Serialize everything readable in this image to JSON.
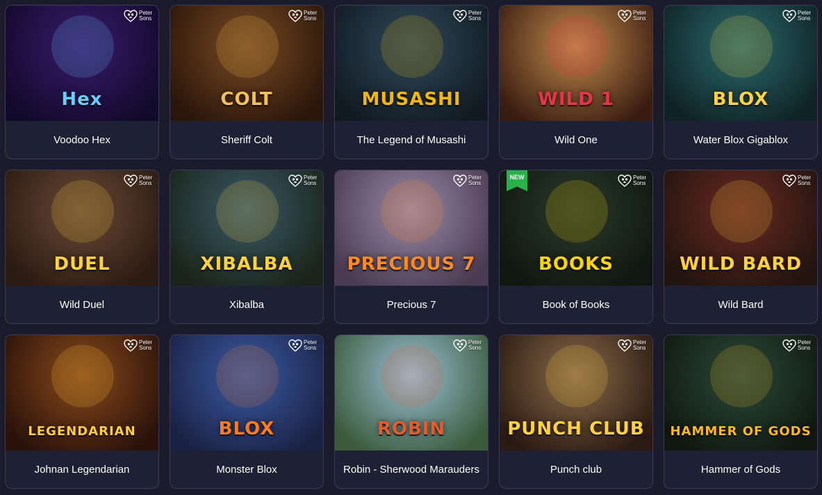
{
  "provider": {
    "line1": "Peter",
    "line2": "Sons",
    "icon": "heart-skull-logo"
  },
  "games": [
    {
      "title": "Voodoo Hex",
      "art_title": "Hex",
      "bg1": "#3a1a6e",
      "bg2": "#120a2a",
      "accent": "#5fd0ff"
    },
    {
      "title": "Sheriff Colt",
      "art_title": "COLT",
      "bg1": "#7a4a22",
      "bg2": "#2a160a",
      "accent": "#f2c14e"
    },
    {
      "title": "The Legend of Musashi",
      "art_title": "MUSASHI",
      "bg1": "#2f4a5a",
      "bg2": "#111a22",
      "accent": "#f5b800"
    },
    {
      "title": "Wild One",
      "art_title": "WILD 1",
      "bg1": "#c08a4a",
      "bg2": "#3a1d12",
      "accent": "#e8344a"
    },
    {
      "title": "Water Blox Gigablox",
      "art_title": "BLOX",
      "bg1": "#2b6a6a",
      "bg2": "#0f2226",
      "accent": "#ffd23a"
    },
    {
      "title": "Wild Duel",
      "art_title": "DUEL",
      "bg1": "#6a4a36",
      "bg2": "#2a1a12",
      "accent": "#ffd23a"
    },
    {
      "title": "Xibalba",
      "art_title": "XIBALBA",
      "bg1": "#3a5a6a",
      "bg2": "#1a2418",
      "accent": "#ffd23a"
    },
    {
      "title": "Precious 7",
      "art_title": "PRECIOUS 7",
      "bg1": "#9a8aa4",
      "bg2": "#4a3a52",
      "accent": "#ff8a20"
    },
    {
      "title": "Book of Books",
      "art_title": "BOOKS",
      "bg1": "#2a3a2a",
      "bg2": "#0f1710",
      "accent": "#ffd400",
      "badge": "NEW"
    },
    {
      "title": "Wild Bard",
      "art_title": "WILD BARD",
      "bg1": "#6a2a22",
      "bg2": "#22140f",
      "accent": "#ffd23a"
    },
    {
      "title": "Johnan Legendarian",
      "art_title": "LEGENDARIAN",
      "bg1": "#8a4a1a",
      "bg2": "#2a120a",
      "accent": "#ffce3a"
    },
    {
      "title": "Monster Blox",
      "art_title": "BLOX",
      "bg1": "#3a5aa4",
      "bg2": "#1a2244",
      "accent": "#ff7a1a"
    },
    {
      "title": "Robin - Sherwood Marauders",
      "art_title": "ROBIN",
      "bg1": "#9ac0d8",
      "bg2": "#3a5a3a",
      "accent": "#e85a2a"
    },
    {
      "title": "Punch club",
      "art_title": "PUNCH CLUB",
      "bg1": "#8a6a4a",
      "bg2": "#2a1a12",
      "accent": "#ffd23a"
    },
    {
      "title": "Hammer of Gods",
      "art_title": "HAMMER OF GODS",
      "bg1": "#2a4a3a",
      "bg2": "#10180f",
      "accent": "#ffb81a"
    }
  ]
}
